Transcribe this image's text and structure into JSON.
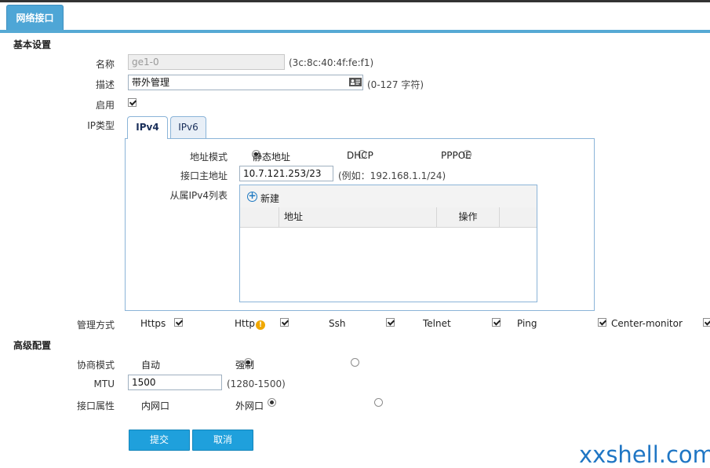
{
  "header": {
    "tab_label": "网络接口"
  },
  "basic": {
    "section_title": "基本设置",
    "name_label": "名称",
    "name_value": "ge1-0",
    "mac_hint": "(3c:8c:40:4f:fe:f1)",
    "desc_label": "描述",
    "desc_value": "带外管理",
    "desc_hint": "(0-127 字符)",
    "enable_label": "启用",
    "enable_checked": true,
    "ip_type_label": "IP类型"
  },
  "ip_tabs": [
    {
      "label": "IPv4",
      "active": true
    },
    {
      "label": "IPv6",
      "active": false
    }
  ],
  "ipv4": {
    "addr_mode_label": "地址模式",
    "modes": [
      {
        "label": "静态地址",
        "selected": true
      },
      {
        "label": "DHCP",
        "selected": false
      },
      {
        "label": "PPPOE",
        "selected": false
      }
    ],
    "primary_label": "接口主地址",
    "primary_value": "10.7.121.253/23",
    "primary_hint": "(例如：192.168.1.1/24)",
    "secondary_label": "从属IPv4列表",
    "new_button": "新建",
    "columns": [
      "地址",
      "操作"
    ]
  },
  "management": {
    "label": "管理方式",
    "items": [
      {
        "label": "Https",
        "checked": true
      },
      {
        "label": "Http",
        "checked": true,
        "warning": true
      },
      {
        "label": "Ssh",
        "checked": true
      },
      {
        "label": "Telnet",
        "checked": true
      },
      {
        "label": "Ping",
        "checked": true
      },
      {
        "label": "Center-monitor",
        "checked": true
      }
    ]
  },
  "advanced": {
    "section_title": "高级配置",
    "negotiation_label": "协商模式",
    "negotiation_options": [
      {
        "label": "自动",
        "selected": true
      },
      {
        "label": "强制",
        "selected": false
      }
    ],
    "mtu_label": "MTU",
    "mtu_value": "1500",
    "mtu_hint": "(1280-1500)",
    "attr_label": "接口属性",
    "attr_options": [
      {
        "label": "内网口",
        "selected": true
      },
      {
        "label": "外网口",
        "selected": false
      }
    ]
  },
  "actions": {
    "submit": "提交",
    "cancel": "取消"
  },
  "watermark": "xxshell.com",
  "colors": {
    "accent": "#4ea6d6",
    "button": "#1fa0dc",
    "border": "#8bb4d8",
    "watermark": "#1f76c4"
  },
  "icons": {
    "desc_field": "contact-card-icon",
    "new": "plus-circle-icon",
    "http_warning": "warning-icon"
  }
}
